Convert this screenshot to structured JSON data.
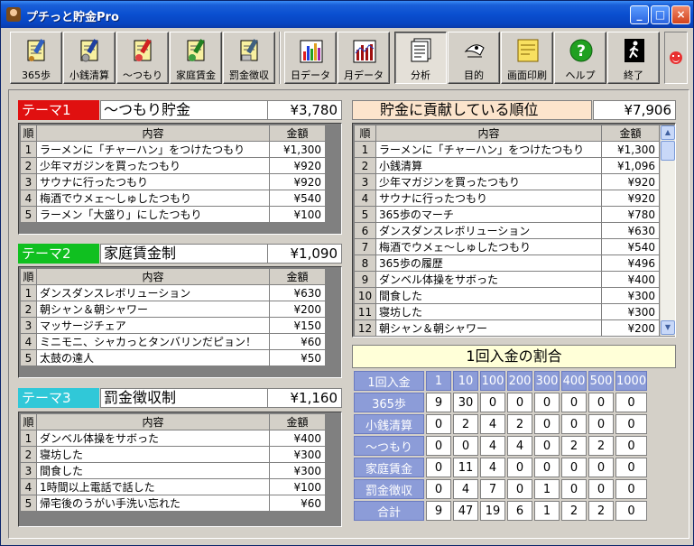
{
  "window": {
    "title": "プチっと貯金Pro"
  },
  "toolbar": {
    "buttons": [
      {
        "label": "365歩",
        "icon": "notebook-pencil-icon"
      },
      {
        "label": "小銭清算",
        "icon": "notebook-coins-icon"
      },
      {
        "label": "〜つもり",
        "icon": "notebook-red-icon"
      },
      {
        "label": "家庭賃金",
        "icon": "notebook-green-icon"
      },
      {
        "label": "罰金徴収",
        "icon": "notebook-scroll-icon"
      },
      {
        "label": "日データ",
        "icon": "bar-chart-icon"
      },
      {
        "label": "月データ",
        "icon": "monthly-chart-icon"
      },
      {
        "label": "分析",
        "icon": "analysis-icon"
      },
      {
        "label": "目的",
        "icon": "target-icon"
      },
      {
        "label": "画面印刷",
        "icon": "print-icon"
      },
      {
        "label": "ヘルプ",
        "icon": "help-icon"
      },
      {
        "label": "終了",
        "icon": "exit-icon"
      }
    ]
  },
  "theme1": {
    "tag": "テーマ1",
    "name": "〜つもり貯金",
    "amount": "¥3,780",
    "headers": [
      "順",
      "内容",
      "金額"
    ],
    "rows": [
      {
        "no": "1",
        "desc": "ラーメンに「チャーハン」をつけたつもり",
        "amt": "¥1,300"
      },
      {
        "no": "2",
        "desc": "少年マガジンを買ったつもり",
        "amt": "¥920"
      },
      {
        "no": "3",
        "desc": "サウナに行ったつもり",
        "amt": "¥920"
      },
      {
        "no": "4",
        "desc": "梅酒でウメェ〜しゅしたつもり",
        "amt": "¥540"
      },
      {
        "no": "5",
        "desc": "ラーメン「大盛り」にしたつもり",
        "amt": "¥100"
      }
    ]
  },
  "theme2": {
    "tag": "テーマ2",
    "name": "家庭賃金制",
    "amount": "¥1,090",
    "headers": [
      "順",
      "内容",
      "金額"
    ],
    "rows": [
      {
        "no": "1",
        "desc": "ダンスダンスレボリューション",
        "amt": "¥630"
      },
      {
        "no": "2",
        "desc": "朝シャン＆朝シャワー",
        "amt": "¥200"
      },
      {
        "no": "3",
        "desc": "マッサージチェア",
        "amt": "¥150"
      },
      {
        "no": "4",
        "desc": "ミニモニ、シャカっとタンバリンだピョン！",
        "amt": "¥60"
      },
      {
        "no": "5",
        "desc": "太鼓の達人",
        "amt": "¥50"
      }
    ]
  },
  "theme3": {
    "tag": "テーマ3",
    "name": "罰金徴収制",
    "amount": "¥1,160",
    "headers": [
      "順",
      "内容",
      "金額"
    ],
    "rows": [
      {
        "no": "1",
        "desc": "ダンベル体操をサボった",
        "amt": "¥400"
      },
      {
        "no": "2",
        "desc": "寝坊した",
        "amt": "¥300"
      },
      {
        "no": "3",
        "desc": "間食した",
        "amt": "¥300"
      },
      {
        "no": "4",
        "desc": "1時間以上電話で話した",
        "amt": "¥100"
      },
      {
        "no": "5",
        "desc": "帰宅後のうがい手洗い忘れた",
        "amt": "¥60"
      }
    ]
  },
  "ranking": {
    "title": "貯金に貢献している順位",
    "amount": "¥7,906",
    "headers": [
      "順",
      "内容",
      "金額"
    ],
    "rows": [
      {
        "no": "1",
        "desc": "ラーメンに「チャーハン」をつけたつもり",
        "amt": "¥1,300"
      },
      {
        "no": "2",
        "desc": "小銭清算",
        "amt": "¥1,096"
      },
      {
        "no": "3",
        "desc": "少年マガジンを買ったつもり",
        "amt": "¥920"
      },
      {
        "no": "4",
        "desc": "サウナに行ったつもり",
        "amt": "¥920"
      },
      {
        "no": "5",
        "desc": "365歩のマーチ",
        "amt": "¥780"
      },
      {
        "no": "6",
        "desc": "ダンスダンスレボリューション",
        "amt": "¥630"
      },
      {
        "no": "7",
        "desc": "梅酒でウメェ〜しゅしたつもり",
        "amt": "¥540"
      },
      {
        "no": "8",
        "desc": "365歩の履歴",
        "amt": "¥496"
      },
      {
        "no": "9",
        "desc": "ダンベル体操をサボった",
        "amt": "¥400"
      },
      {
        "no": "10",
        "desc": "間食した",
        "amt": "¥300"
      },
      {
        "no": "11",
        "desc": "寝坊した",
        "amt": "¥300"
      },
      {
        "no": "12",
        "desc": "朝シャン＆朝シャワー",
        "amt": "¥200"
      }
    ]
  },
  "ratio": {
    "title": "1回入金の割合",
    "corner": "1回入金",
    "columns": [
      "1",
      "10",
      "100",
      "200",
      "300",
      "400",
      "500",
      "1000"
    ],
    "rows": [
      {
        "label": "365歩",
        "values": [
          "9",
          "30",
          "0",
          "0",
          "0",
          "0",
          "0",
          "0"
        ]
      },
      {
        "label": "小銭清算",
        "values": [
          "0",
          "2",
          "4",
          "2",
          "0",
          "0",
          "0",
          "0"
        ]
      },
      {
        "label": "〜つもり",
        "values": [
          "0",
          "0",
          "4",
          "4",
          "0",
          "2",
          "2",
          "0"
        ]
      },
      {
        "label": "家庭賃金",
        "values": [
          "0",
          "11",
          "4",
          "0",
          "0",
          "0",
          "0",
          "0"
        ]
      },
      {
        "label": "罰金徴収",
        "values": [
          "0",
          "4",
          "7",
          "0",
          "1",
          "0",
          "0",
          "0"
        ]
      },
      {
        "label": "合計",
        "values": [
          "9",
          "47",
          "19",
          "6",
          "1",
          "2",
          "2",
          "0"
        ]
      }
    ]
  },
  "colors": {
    "theme1": "#e01010",
    "theme2": "#10c020",
    "theme3": "#30c8d8",
    "ranking_head": "#fce4cc",
    "ratio_head": "#8c9cd8"
  }
}
